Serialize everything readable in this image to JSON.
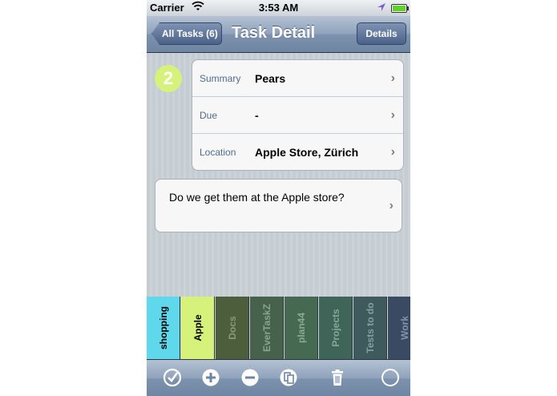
{
  "status": {
    "carrier": "Carrier",
    "time": "3:53 AM"
  },
  "nav": {
    "back_label": "All Tasks (6)",
    "title": "Task Detail",
    "details_label": "Details"
  },
  "badge": "2",
  "fields": [
    {
      "label": "Summary",
      "value": "Pears"
    },
    {
      "label": "Due",
      "value": "-"
    },
    {
      "label": "Location",
      "value": "Apple Store, Zürich"
    }
  ],
  "note": "Do we get them at the Apple store?",
  "categories": [
    {
      "name": "shopping",
      "bg": "#5fd8eb",
      "fg": "#000000"
    },
    {
      "name": "Apple",
      "bg": "#d7f27b",
      "fg": "#000000"
    },
    {
      "name": "Docs",
      "bg": "#4d5e3d",
      "fg": "#8a9a78"
    },
    {
      "name": "EverTaskZ",
      "bg": "#46624c",
      "fg": "#8aa48e"
    },
    {
      "name": "plan44",
      "bg": "#466951",
      "fg": "#8aaa92"
    },
    {
      "name": "Projects",
      "bg": "#3f6558",
      "fg": "#86a89a"
    },
    {
      "name": "Tests to do",
      "bg": "#3f5a5c",
      "fg": "#869fa0"
    },
    {
      "name": "Work",
      "bg": "#3a4a62",
      "fg": "#8492aa"
    }
  ],
  "toolbar_icons": [
    "checkmark-icon",
    "add-icon",
    "remove-icon",
    "copy-icon",
    "trash-icon",
    "circle-icon"
  ]
}
